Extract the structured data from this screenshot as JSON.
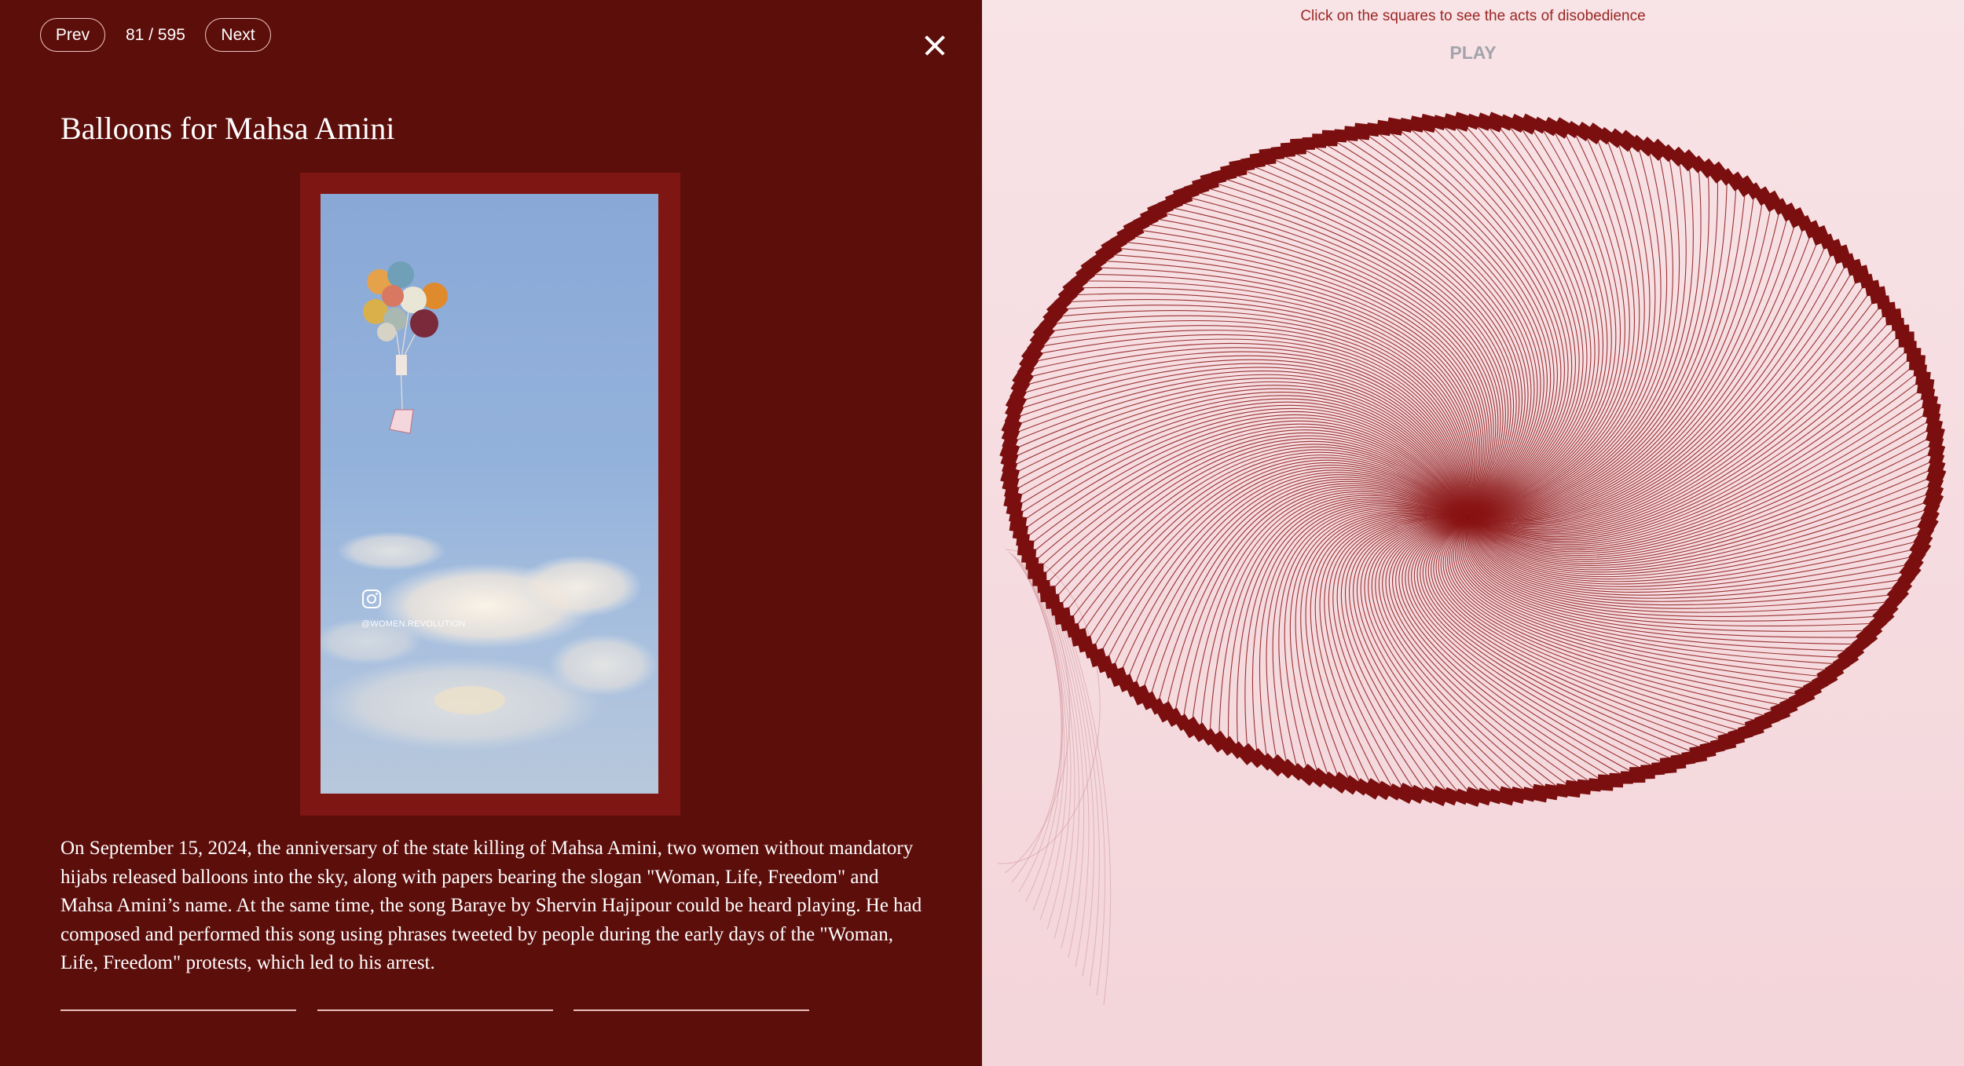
{
  "nav": {
    "prev_label": "Prev",
    "counter": "81 / 595",
    "next_label": "Next",
    "close_icon": "close-icon"
  },
  "entry": {
    "title": "Balloons for Mahsa Amini",
    "media": {
      "kind": "video-still",
      "watermark_icon": "instagram-icon",
      "watermark_text": "@WOMEN.REVOLUTION"
    },
    "description": "On September 15, 2024, the anniversary of the state killing of Mahsa Amini, two women without mandatory hijabs released balloons into the sky, along with papers bearing the slogan \"Woman, Life, Freedom\" and Mahsa Amini’s name. At the same time, the song Baraye by Shervin Hajipour could be heard playing. He had composed and performed this song using phrases tweeted by people during the early days of the \"Woman, Life, Freedom\" protests, which led to his arrest."
  },
  "visualization": {
    "instruction": "Click on the squares to see the acts of disobedience",
    "play_label": "PLAY",
    "colors": {
      "square": "#7b0f0f",
      "line": "#8a1414",
      "background": "#f6dde1"
    }
  },
  "colors": {
    "panel_bg": "#5c0e0b",
    "frame": "#7e1713",
    "text": "#ffffff"
  }
}
